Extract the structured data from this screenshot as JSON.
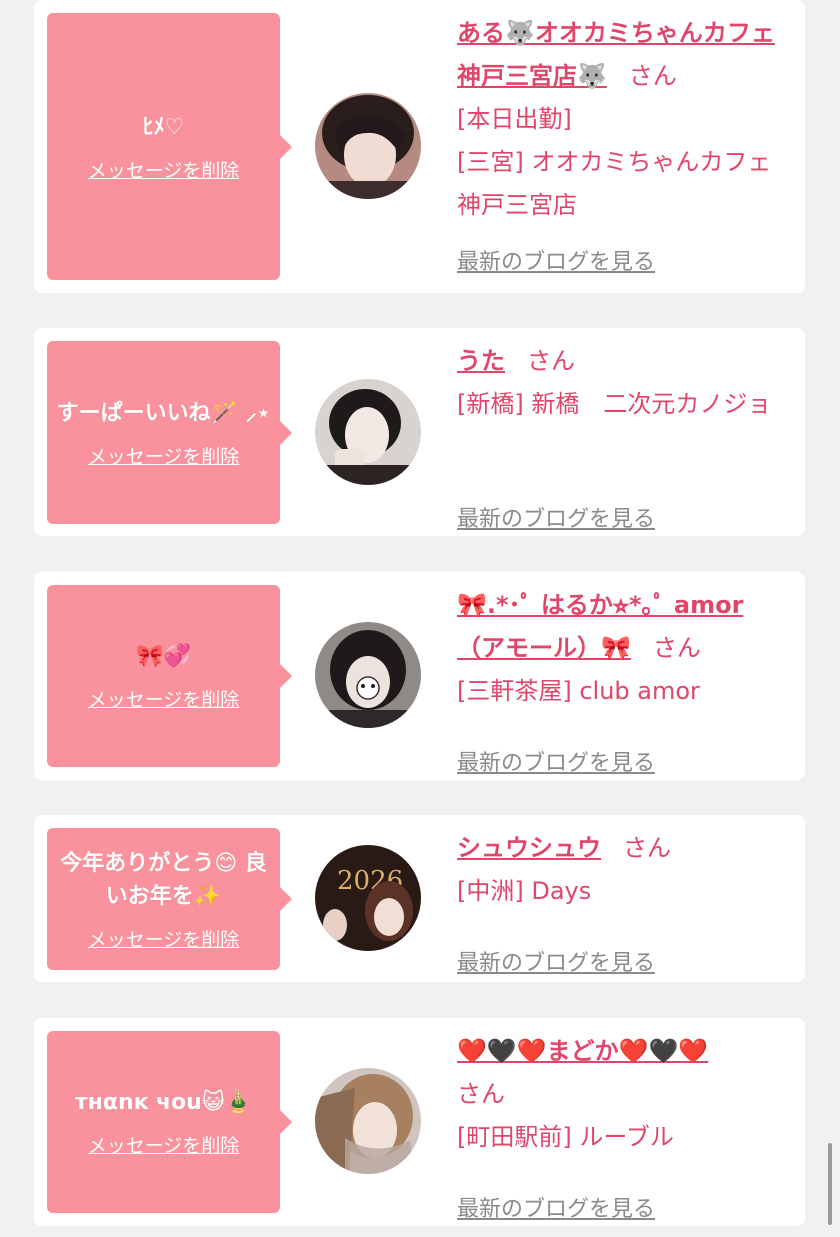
{
  "common": {
    "delete_label": "メッセージを削除",
    "blog_label": "最新のブログを見る",
    "san_label": "さん"
  },
  "cards": [
    {
      "message": "ﾋﾒ♡",
      "name": "ある🐺オオカミちゃんカフェ神戸三宮店🐺",
      "lines": [
        "[本日出勤]",
        "[三宮] オオカミちゃんカフェ神戸三宮店"
      ]
    },
    {
      "message": "すーぱーいいね🪄 ⸝⋆",
      "name": "うた",
      "lines": [
        "[新橋] 新橋　二次元カノジョ"
      ]
    },
    {
      "message": "🎀💞",
      "name": "🎀.*･ﾟ はるか⭐︎*｡ﾟ amor （アモール）🎀",
      "lines": [
        "[三軒茶屋] club amor"
      ]
    },
    {
      "message": "今年ありがとう😊 良いお年を✨",
      "name": "シュウシュウ",
      "lines": [
        "[中洲] Days"
      ]
    },
    {
      "message": "тнαnĸ чou😺🎍",
      "name": "❤️🖤❤️まどか❤️🖤❤️",
      "lines": [
        "[町田駅前] ルーブル"
      ]
    }
  ],
  "colors": {
    "bubble": "#f9929d",
    "accent": "#e0466a",
    "link_gray": "#8a8a8a",
    "card": "#ffffff",
    "page": "#f1f1f1"
  }
}
